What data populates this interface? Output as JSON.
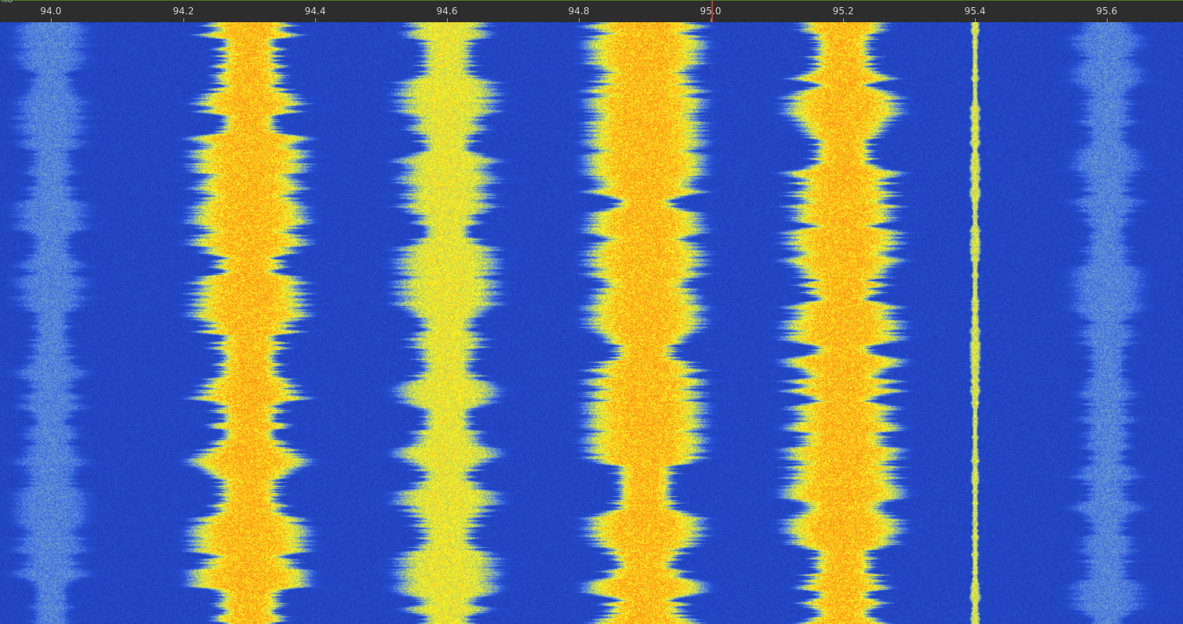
{
  "axis": {
    "corner_label": "%8",
    "ticks": [
      "94.0",
      "94.2",
      "94.4",
      "94.6",
      "94.8",
      "95.0",
      "95.2",
      "95.4",
      "95.6"
    ],
    "tuned_frequency": "95.0"
  },
  "waterfall": {
    "colors": {
      "background": "#1f3fb5",
      "signal": "#ffff1a",
      "peak": "#ff9a1a",
      "weak": "#9fc27a"
    },
    "signals": [
      {
        "freq": 94.0,
        "strength": "weak"
      },
      {
        "freq": 94.3,
        "strength": "strong"
      },
      {
        "freq": 94.6,
        "strength": "medium"
      },
      {
        "freq": 94.9,
        "strength": "strong"
      },
      {
        "freq": 95.2,
        "strength": "strong"
      },
      {
        "freq": 95.4,
        "strength": "narrow"
      },
      {
        "freq": 95.6,
        "strength": "weak"
      }
    ]
  }
}
